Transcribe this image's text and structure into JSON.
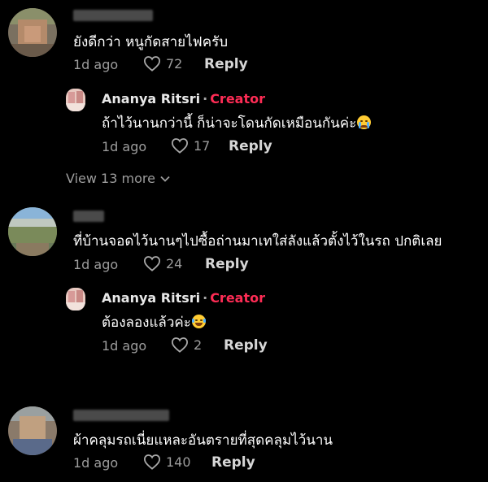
{
  "comments": [
    {
      "text": "ยังดีกว่า หนูกัดสายไฟครับ",
      "time": "1d ago",
      "likes": "72",
      "reply_label": "Reply",
      "reply": {
        "author": "Ananya Ritsri",
        "separator": "·",
        "badge": "Creator",
        "text": "ถ้าไว้นานกว่านี้ ก็น่าจะโดนกัดเหมือนกันค่ะ",
        "emoji": "crying-face-emoji",
        "time": "1d ago",
        "likes": "17",
        "reply_label": "Reply"
      },
      "view_more": "View 13 more"
    },
    {
      "text": "ที่บ้านจอดไว้นานๆไปซื้อถ่านมาเทใส่ลังแล้วตั้งไว้ในรถ ปกติเลย",
      "time": "1d ago",
      "likes": "24",
      "reply_label": "Reply",
      "reply": {
        "author": "Ananya Ritsri",
        "separator": "·",
        "badge": "Creator",
        "text": "ต้องลองแล้วค่ะ",
        "emoji": "laughing-tears-emoji",
        "time": "1d ago",
        "likes": "2",
        "reply_label": "Reply"
      }
    },
    {
      "text": "ผ้าคลุมรถเนี่ยแหละอันตรายที่สุดคลุมไว้นาน",
      "time": "1d ago",
      "likes": "140",
      "reply_label": "Reply"
    }
  ],
  "colors": {
    "background": "#000000",
    "creator_badge": "#fe2c55",
    "meta_text": "#9d9d9d"
  }
}
